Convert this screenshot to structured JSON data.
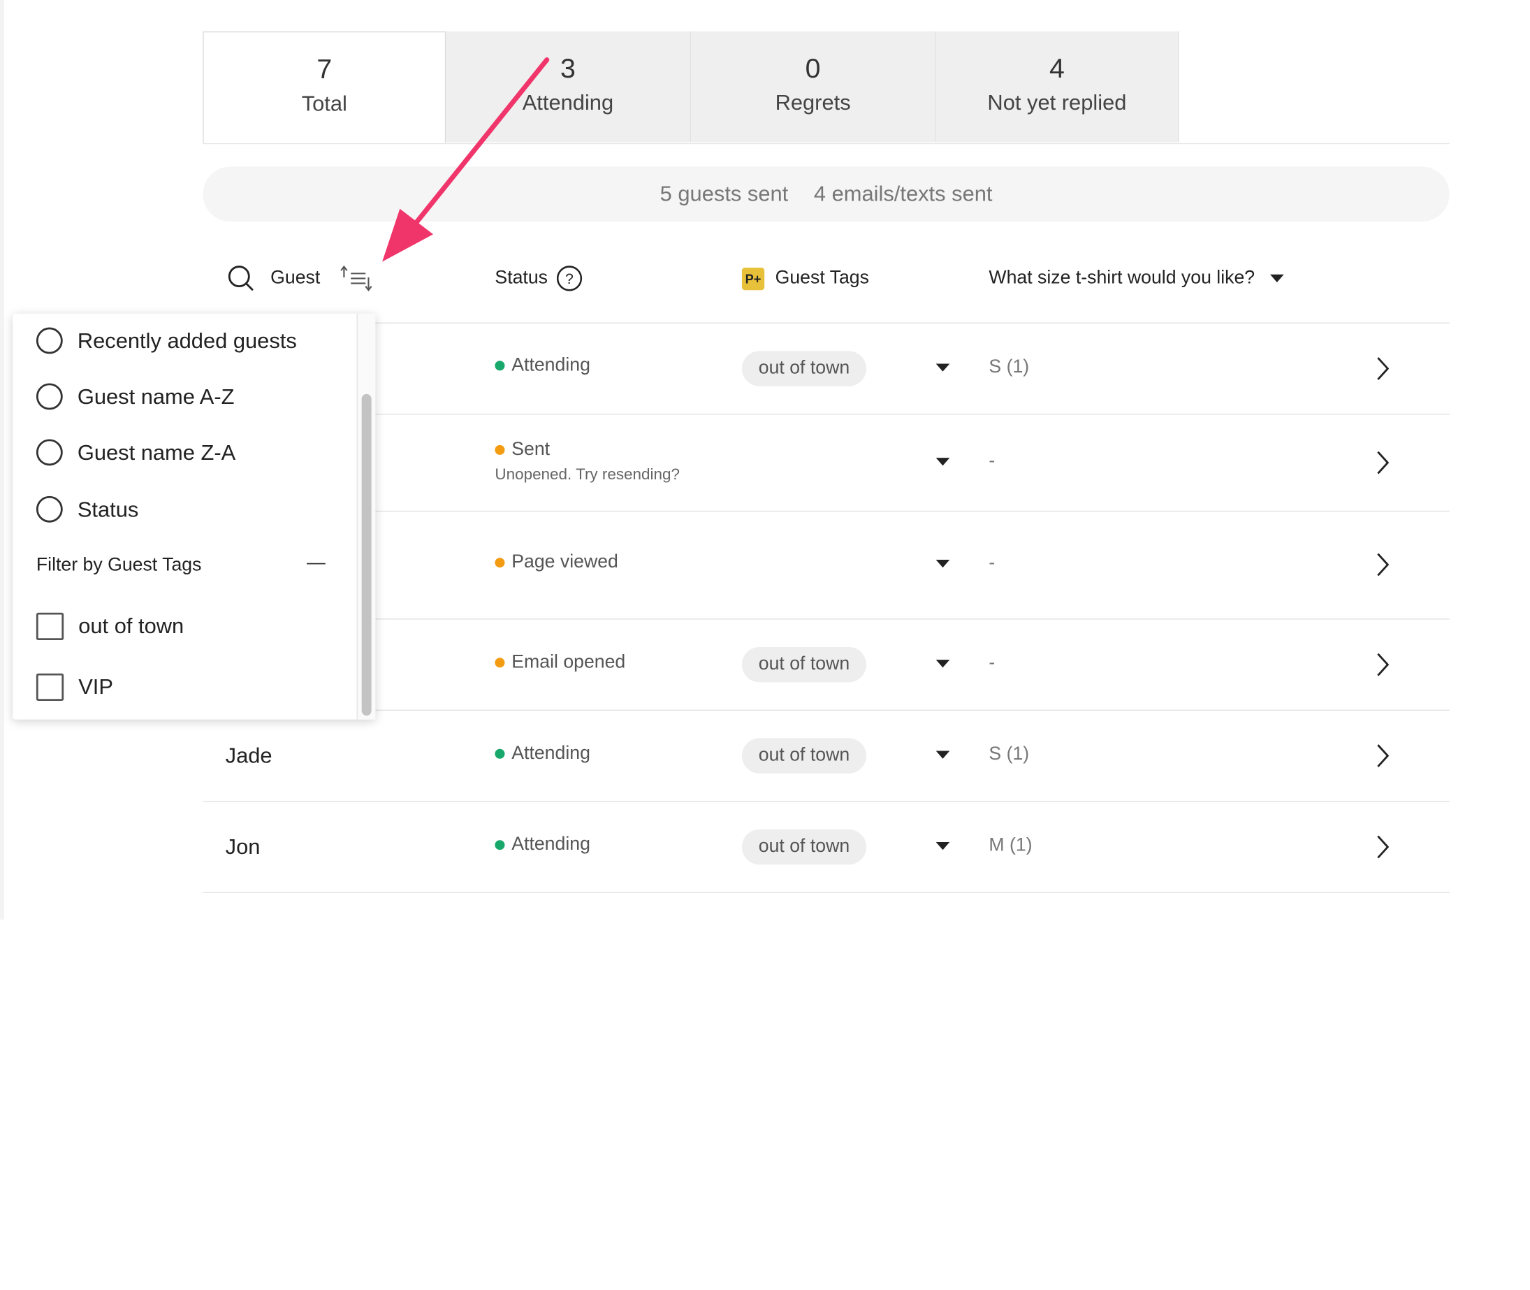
{
  "tabs": [
    {
      "count": "7",
      "label": "Total"
    },
    {
      "count": "3",
      "label": "Attending"
    },
    {
      "count": "0",
      "label": "Regrets"
    },
    {
      "count": "4",
      "label": "Not yet replied"
    }
  ],
  "summary": {
    "guests_sent": "5 guests sent",
    "emails_sent": "4 emails/texts sent"
  },
  "headers": {
    "guest": "Guest",
    "status": "Status",
    "tags_badge": "P+",
    "tags": "Guest Tags",
    "question": "What size t-shirt would you like?"
  },
  "rows": [
    {
      "name": "",
      "status": "Attending",
      "status_sub": "",
      "tag": "out of town",
      "answer": "S (1)"
    },
    {
      "name": "",
      "status": "Sent",
      "status_sub": "Unopened. Try resending?",
      "tag": "",
      "answer": "-"
    },
    {
      "name": "",
      "status": "Page viewed",
      "status_sub": "",
      "tag": "",
      "answer": "-"
    },
    {
      "name": "",
      "status": "Email opened",
      "status_sub": "",
      "tag": "out of town",
      "answer": "-"
    },
    {
      "name": "Jade",
      "status": "Attending",
      "status_sub": "",
      "tag": "out of town",
      "answer": "S (1)"
    },
    {
      "name": "Jon",
      "status": "Attending",
      "status_sub": "",
      "tag": "out of town",
      "answer": "M (1)"
    }
  ],
  "sort_menu": {
    "options": [
      "Recently added guests",
      "Guest name A-Z",
      "Guest name Z-A",
      "Status"
    ],
    "filter_heading": "Filter by Guest Tags",
    "filter_toggle": "—",
    "filter_tags": [
      "out of town",
      "VIP"
    ]
  },
  "colors": {
    "attending": "#19a86b",
    "pending": "#f39c12",
    "annotation_arrow": "#f0356b",
    "tags_badge": "#e8c13a"
  },
  "icons": {
    "search": "search-icon",
    "sort": "sort-icon",
    "help": "help-circle-icon",
    "dropdown": "caret-down-icon",
    "row_open": "chevron-right-icon"
  }
}
